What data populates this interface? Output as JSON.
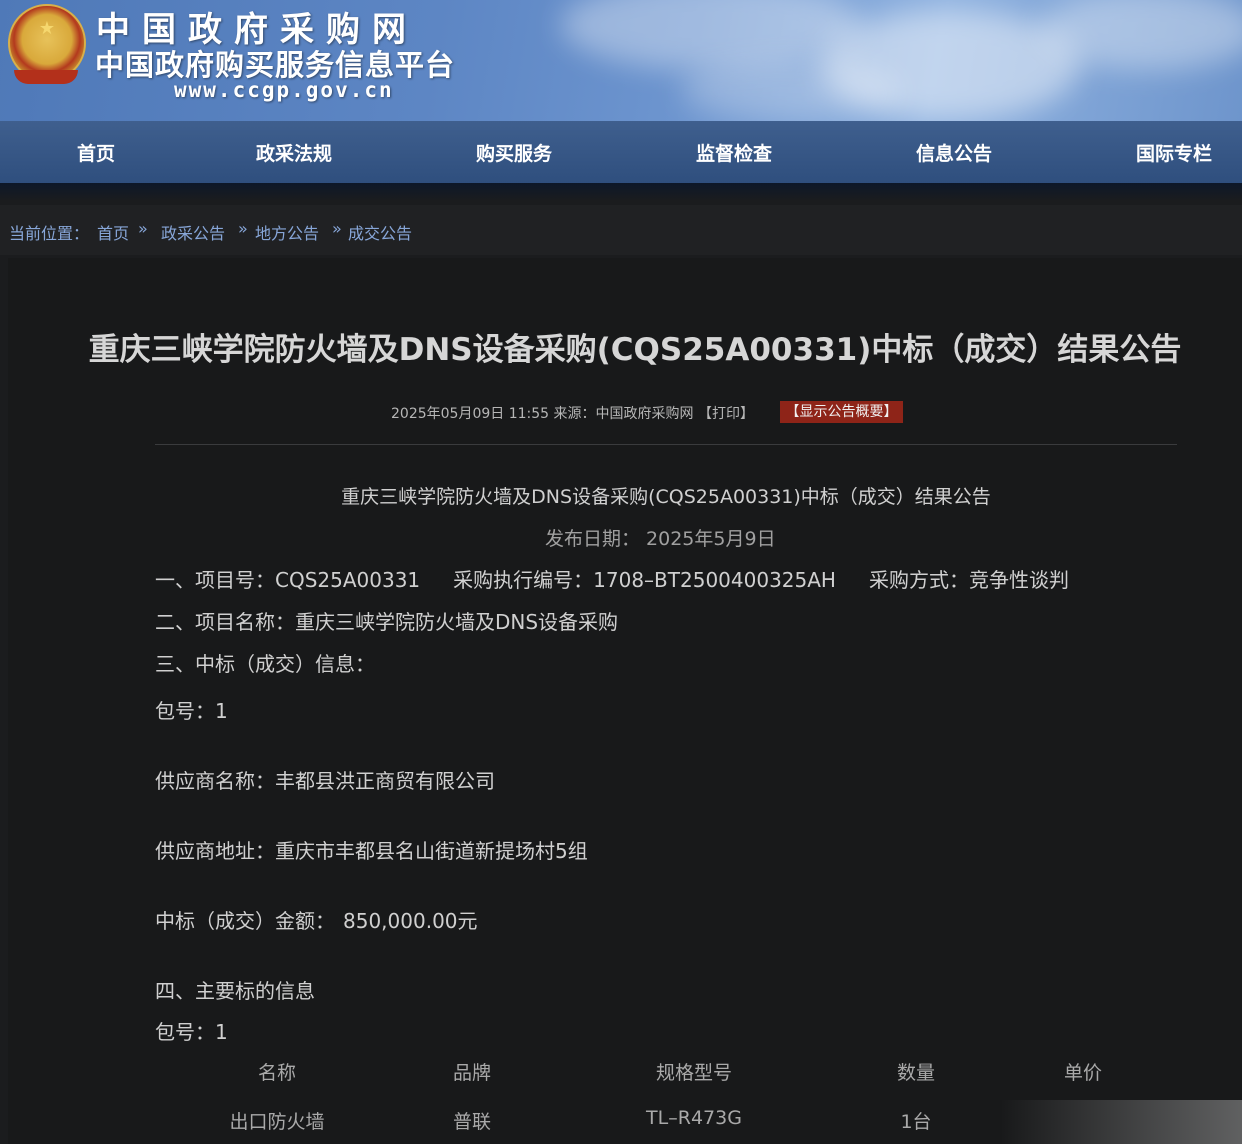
{
  "header": {
    "site_title": "中国政府采购网",
    "site_subtitle": "中国政府购买服务信息平台",
    "site_url": "www.ccgp.gov.cn"
  },
  "nav": {
    "items": [
      {
        "label": "首页"
      },
      {
        "label": "政采法规"
      },
      {
        "label": "购买服务"
      },
      {
        "label": "监督检查"
      },
      {
        "label": "信息公告"
      },
      {
        "label": "国际专栏"
      }
    ]
  },
  "breadcrumb": {
    "prefix": "当前位置：",
    "items": [
      "首页",
      "政采公告",
      "地方公告",
      "成交公告"
    ],
    "separator": "»"
  },
  "article": {
    "title": "重庆三峡学院防火墙及DNS设备采购(CQS25A00331)中标（成交）结果公告",
    "meta_date": "2025年05月09日 11:55",
    "meta_source_label": "来源：",
    "meta_source": "中国政府采购网",
    "print_label": "【打印】",
    "summary_label": "【显示公告概要】",
    "sub_title": "重庆三峡学院防火墙及DNS设备采购(CQS25A00331)中标（成交）结果公告",
    "publish_date": "发布日期：  2025年5月9日",
    "sec1": {
      "label": "一、项目号：",
      "project_no": "CQS25A00331",
      "exec_label": "采购执行编号：",
      "exec_no": "1708–BT2500400325AH",
      "method_label": "采购方式：",
      "method": "竞争性谈判"
    },
    "sec2": {
      "label": "二、项目名称：",
      "value": "重庆三峡学院防火墙及DNS设备采购"
    },
    "sec3": {
      "label": "三、中标（成交）信息："
    },
    "package": {
      "label": "包号：",
      "value": "1"
    },
    "supplier_name": {
      "label": "供应商名称：",
      "value": "丰都县洪正商贸有限公司"
    },
    "supplier_addr": {
      "label": "供应商地址：",
      "value": "重庆市丰都县名山街道新提场村5组"
    },
    "amount": {
      "label": "中标（成交）金额：",
      "value": "850,000.00元"
    },
    "sec4": {
      "label": "四、主要标的信息"
    },
    "package2": {
      "label": "包号：",
      "value": "1"
    },
    "table": {
      "headers": [
        "名称",
        "品牌",
        "规格型号",
        "数量",
        "单价"
      ],
      "rows": [
        [
          "出口防火墙",
          "普联",
          "TL–R473G",
          "1台",
          ""
        ]
      ]
    }
  }
}
